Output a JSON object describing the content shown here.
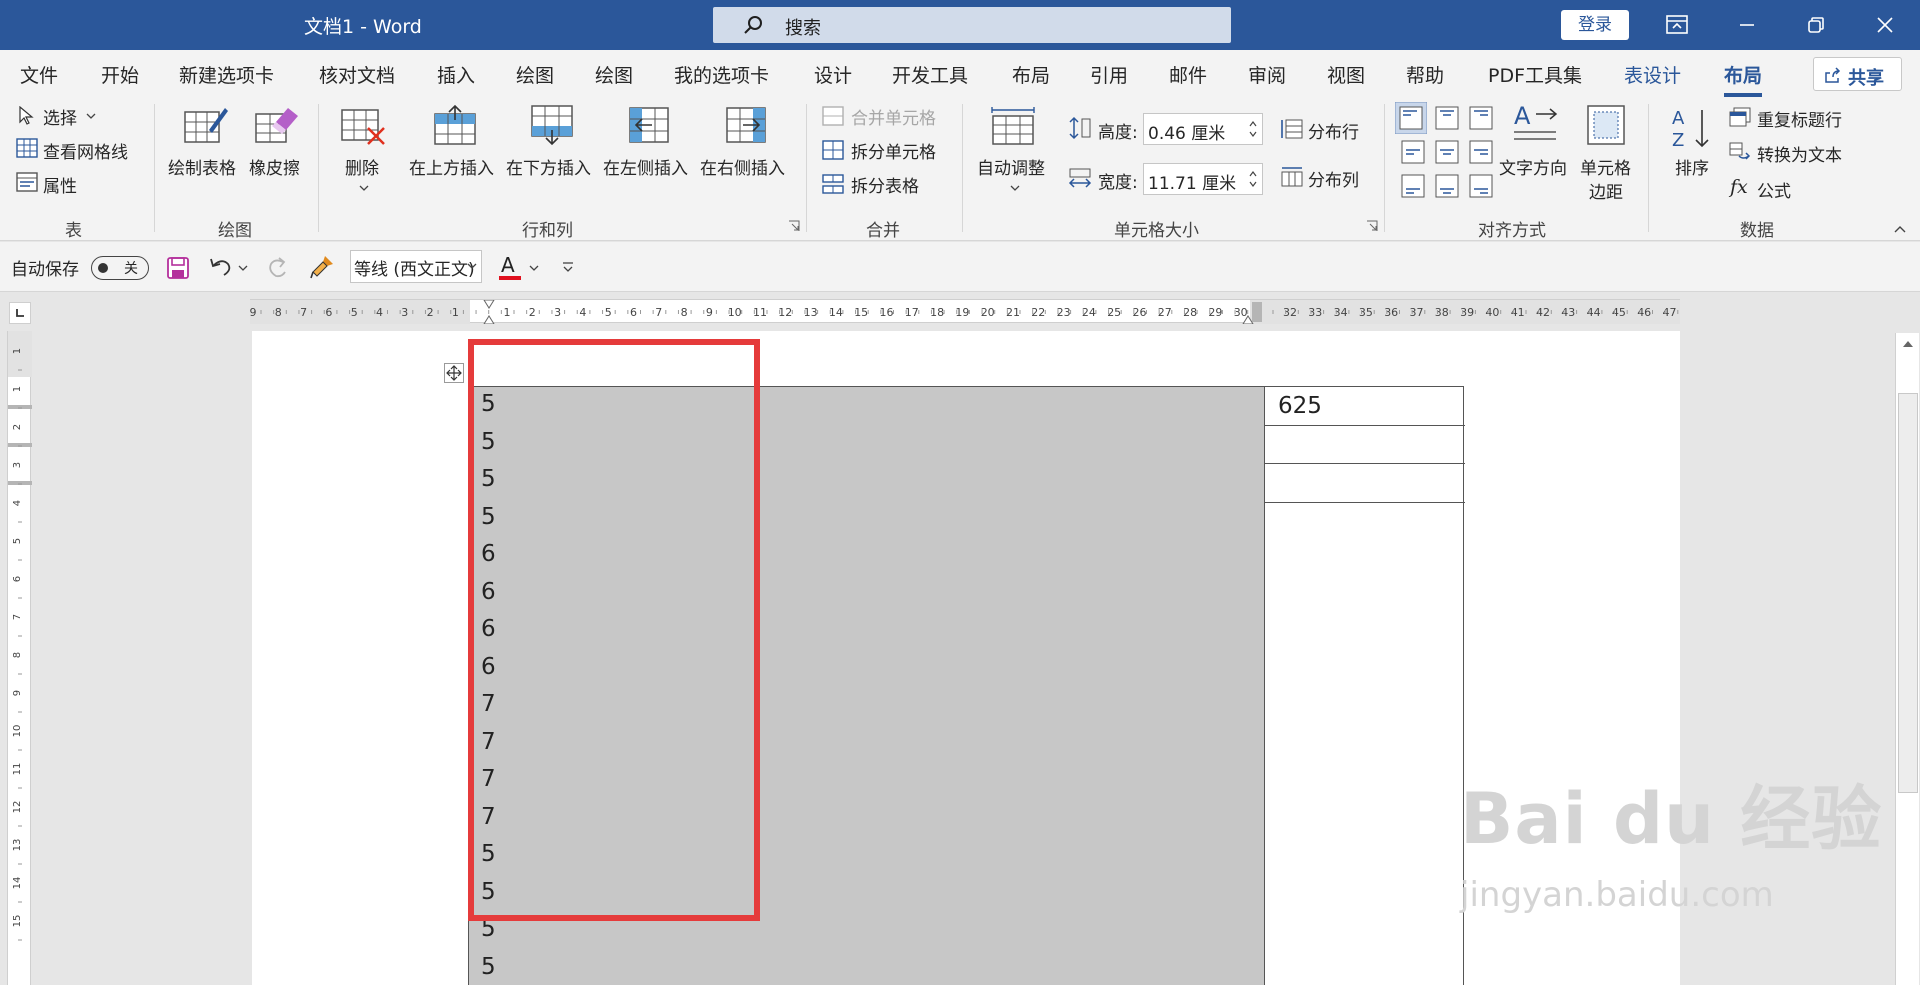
{
  "titlebar": {
    "title": "文档1  -  Word",
    "search_placeholder": "搜索",
    "login_label": "登录"
  },
  "tabs": [
    "文件",
    "开始",
    "新建选项卡",
    "核对文档",
    "插入",
    "绘图",
    "绘图",
    "我的选项卡",
    "设计",
    "开发工具",
    "布局",
    "引用",
    "邮件",
    "审阅",
    "视图",
    "帮助",
    "PDF工具集",
    "表设计",
    "布局"
  ],
  "share_label": "共享",
  "ribbon": {
    "table_group": {
      "name": "表",
      "select": "选择",
      "gridlines": "查看网格线",
      "properties": "属性"
    },
    "draw_group": {
      "name": "绘图",
      "draw_table": "绘制表格",
      "eraser": "橡皮擦"
    },
    "rows_cols_group": {
      "name": "行和列",
      "delete": "删除",
      "insert_above": "在上方插入",
      "insert_below": "在下方插入",
      "insert_left": "在左侧插入",
      "insert_right": "在右侧插入"
    },
    "merge_group": {
      "name": "合并",
      "merge_cells": "合并单元格",
      "split_cells": "拆分单元格",
      "split_table": "拆分表格"
    },
    "cell_size_group": {
      "name": "单元格大小",
      "autofit": "自动调整",
      "height_label": "高度:",
      "height_value": "0.46 厘米",
      "width_label": "宽度:",
      "width_value": "11.71 厘米",
      "dist_rows": "分布行",
      "dist_cols": "分布列"
    },
    "align_group": {
      "name": "对齐方式",
      "text_direction": "文字方向",
      "cell_margins_1": "单元格",
      "cell_margins_2": "边距"
    },
    "data_group": {
      "name": "数据",
      "sort": "排序",
      "repeat_header": "重复标题行",
      "convert_text": "转换为文本",
      "formula": "公式"
    }
  },
  "qat": {
    "autosave": "自动保存",
    "toggle": "关",
    "font": "等线 (西文正文)"
  },
  "ruler": {
    "h_left": [
      "9",
      "8",
      "7",
      "6",
      "5",
      "4",
      "3",
      "2",
      "1"
    ],
    "h_mid": [
      "1",
      "2",
      "3",
      "4",
      "5",
      "6",
      "7",
      "8",
      "9",
      "10",
      "11",
      "12",
      "13",
      "14",
      "15",
      "16",
      "17",
      "18",
      "19",
      "20",
      "21",
      "22",
      "23",
      "24",
      "25",
      "26",
      "27",
      "28",
      "29",
      "30"
    ],
    "h_right": [
      "32",
      "33",
      "34",
      "35",
      "36",
      "37",
      "38",
      "39",
      "40",
      "41",
      "42",
      "43",
      "44",
      "45",
      "46",
      "47"
    ],
    "v": [
      "1",
      "1",
      "2",
      "3",
      "4",
      "5",
      "6",
      "7",
      "8",
      "9",
      "10",
      "11",
      "12",
      "13",
      "14",
      "15"
    ]
  },
  "document": {
    "left_column": [
      "5",
      "5",
      "5",
      "5",
      "6",
      "6",
      "6",
      "6",
      "7",
      "7",
      "7",
      "7",
      "5",
      "5",
      "5",
      "5"
    ],
    "right_cell": "625"
  },
  "watermark": {
    "line1": "Bai du 经验",
    "line2": "jingyan.baidu.com"
  }
}
